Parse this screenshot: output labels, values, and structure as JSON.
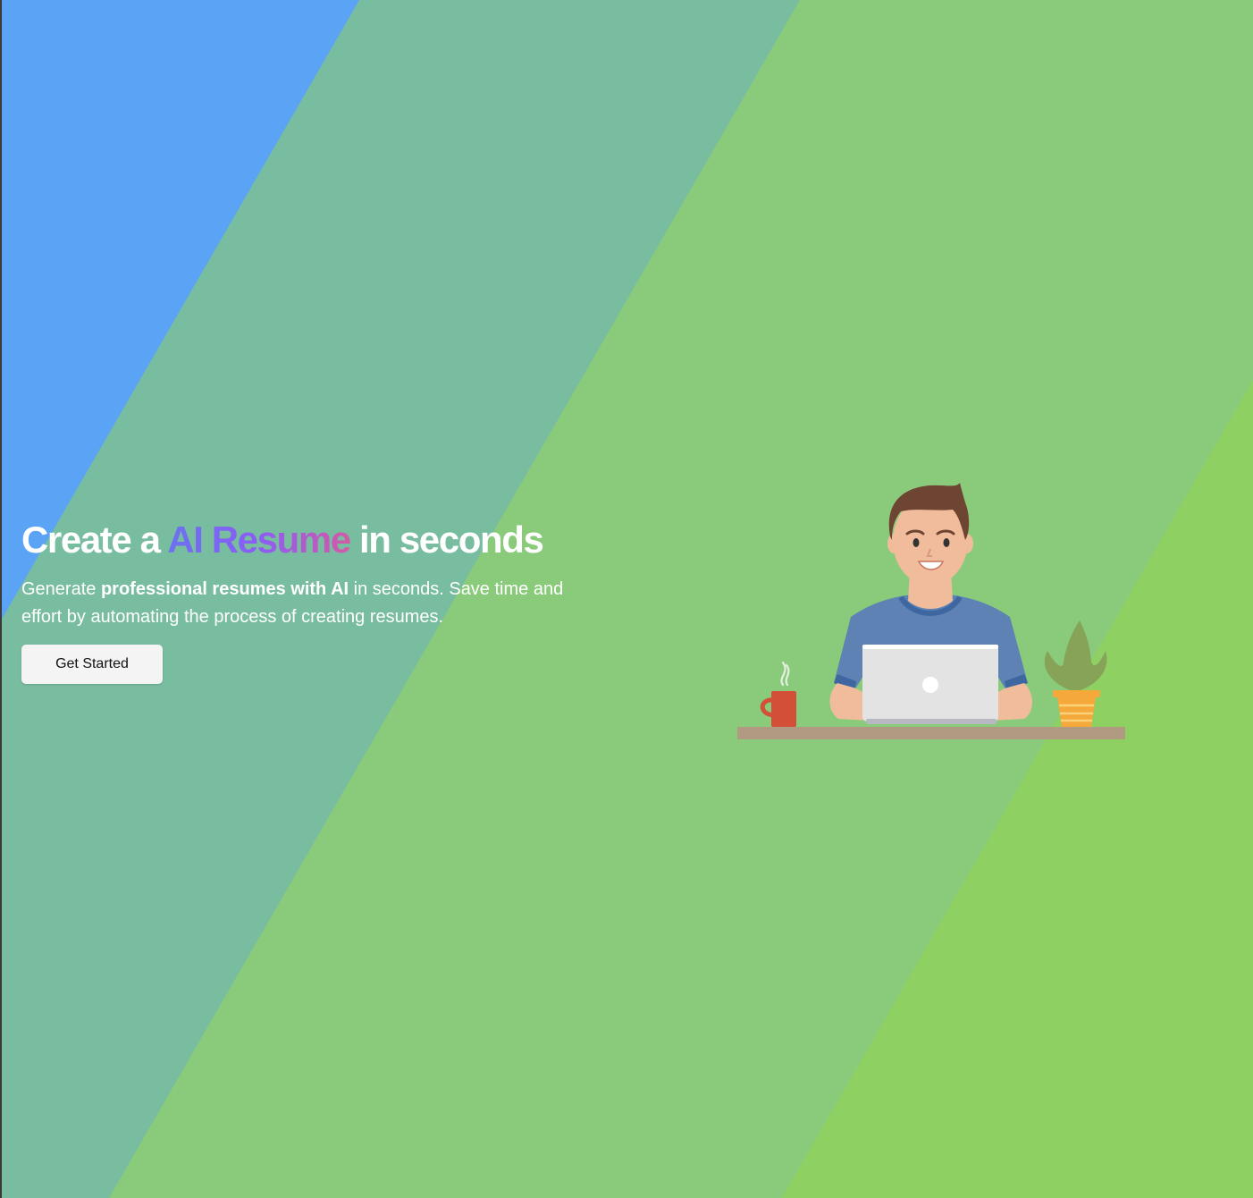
{
  "colors": {
    "background_main": "#8acb7b",
    "band_blue": "#5ba3f5",
    "band_teal": "#79bda0",
    "band_light_green": "#8fd063",
    "title_gradient": [
      "#6b72ef",
      "#8b5cf6",
      "#d55aa6"
    ],
    "button_bg": "#f4f4f4"
  },
  "hero": {
    "title_before": "Create a ",
    "title_highlight": "AI Resume",
    "title_after": " in seconds",
    "desc_prefix": "Generate ",
    "desc_bold": "professional resumes with AI",
    "desc_suffix": " in seconds. Save time and effort by automating the process of creating resumes.",
    "cta_label": "Get Started"
  },
  "illustration": {
    "icon": "person-at-laptop-illustration"
  }
}
